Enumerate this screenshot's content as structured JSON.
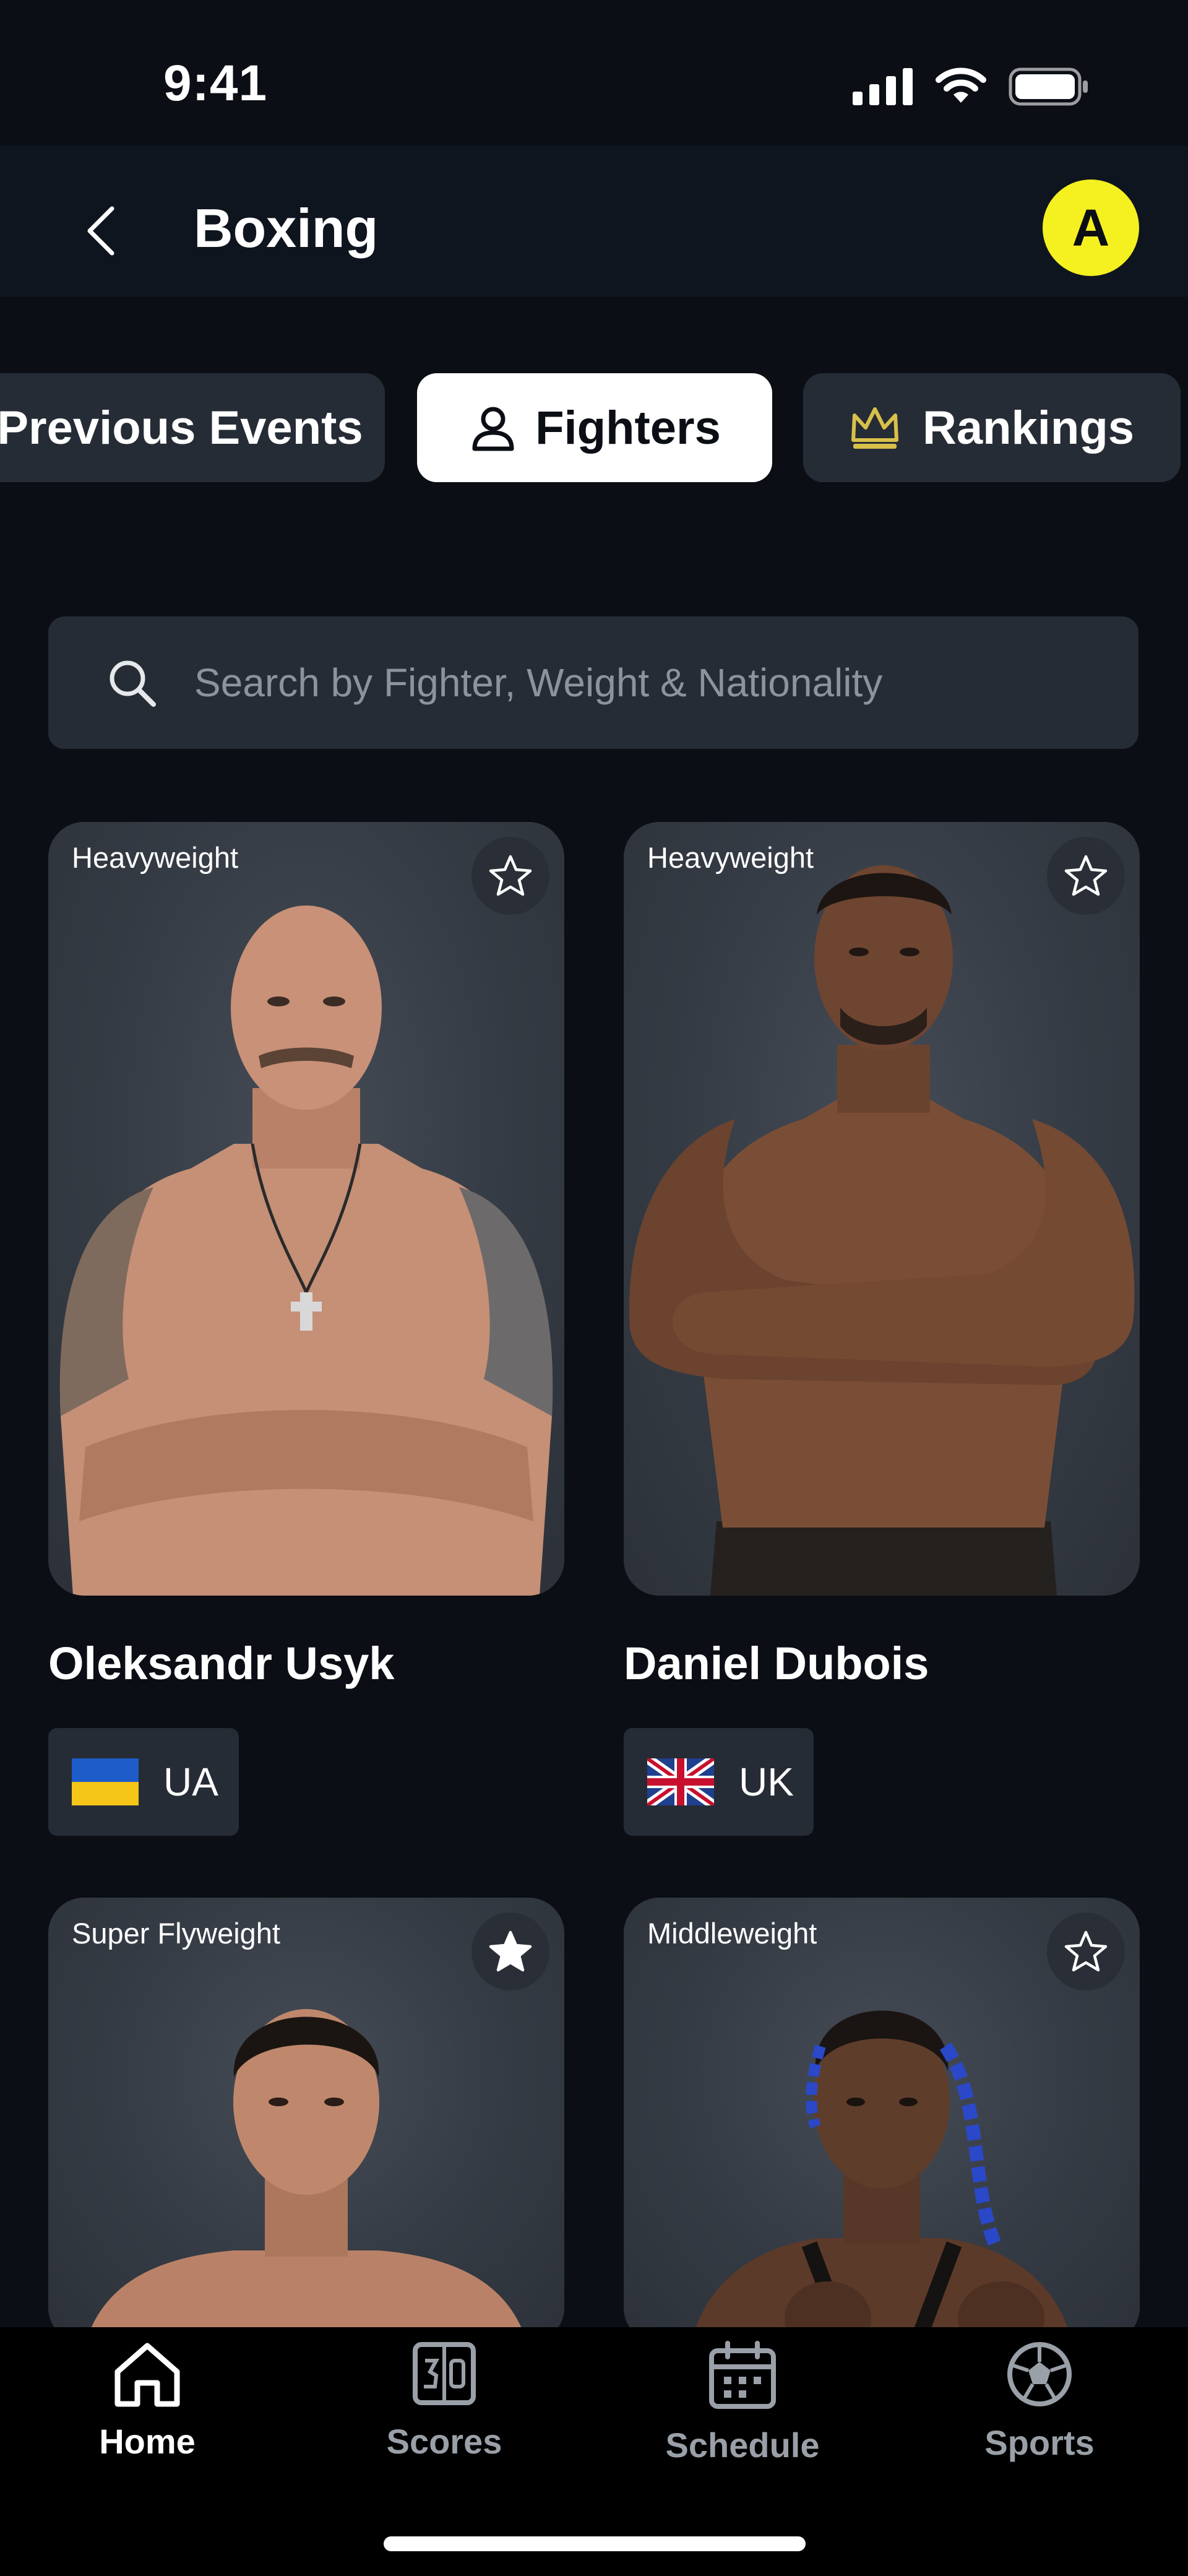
{
  "status_bar": {
    "time": "9:41"
  },
  "header": {
    "title": "Boxing",
    "avatar_letter": "A",
    "back_icon": "chevron-left-icon"
  },
  "tabs": [
    {
      "label": "Previous Events",
      "active": false
    },
    {
      "label": "Fighters",
      "active": true,
      "icon": "person-icon"
    },
    {
      "label": "Rankings",
      "active": false,
      "icon": "crown-icon"
    }
  ],
  "search": {
    "placeholder": "Search by Fighter, Weight & Nationality",
    "value": ""
  },
  "fighters": [
    {
      "name": "Oleksandr Usyk",
      "weight_class": "Heavyweight",
      "country_code": "UA",
      "favorite": false
    },
    {
      "name": "Daniel Dubois",
      "weight_class": "Heavyweight",
      "country_code": "UK",
      "favorite": false
    },
    {
      "weight_class": "Super Flyweight",
      "favorite": true
    },
    {
      "weight_class": "Middleweight",
      "favorite": false
    }
  ],
  "bottom_nav": [
    {
      "label": "Home",
      "icon": "home-icon",
      "active": true
    },
    {
      "label": "Scores",
      "icon": "scoreboard-icon",
      "active": false
    },
    {
      "label": "Schedule",
      "icon": "calendar-icon",
      "active": false
    },
    {
      "label": "Sports",
      "icon": "soccer-ball-icon",
      "active": false
    }
  ],
  "colors": {
    "accent": "#f5f01f",
    "background": "#0b0e14",
    "surface": "#262c35",
    "crown": "#d9c04a"
  }
}
